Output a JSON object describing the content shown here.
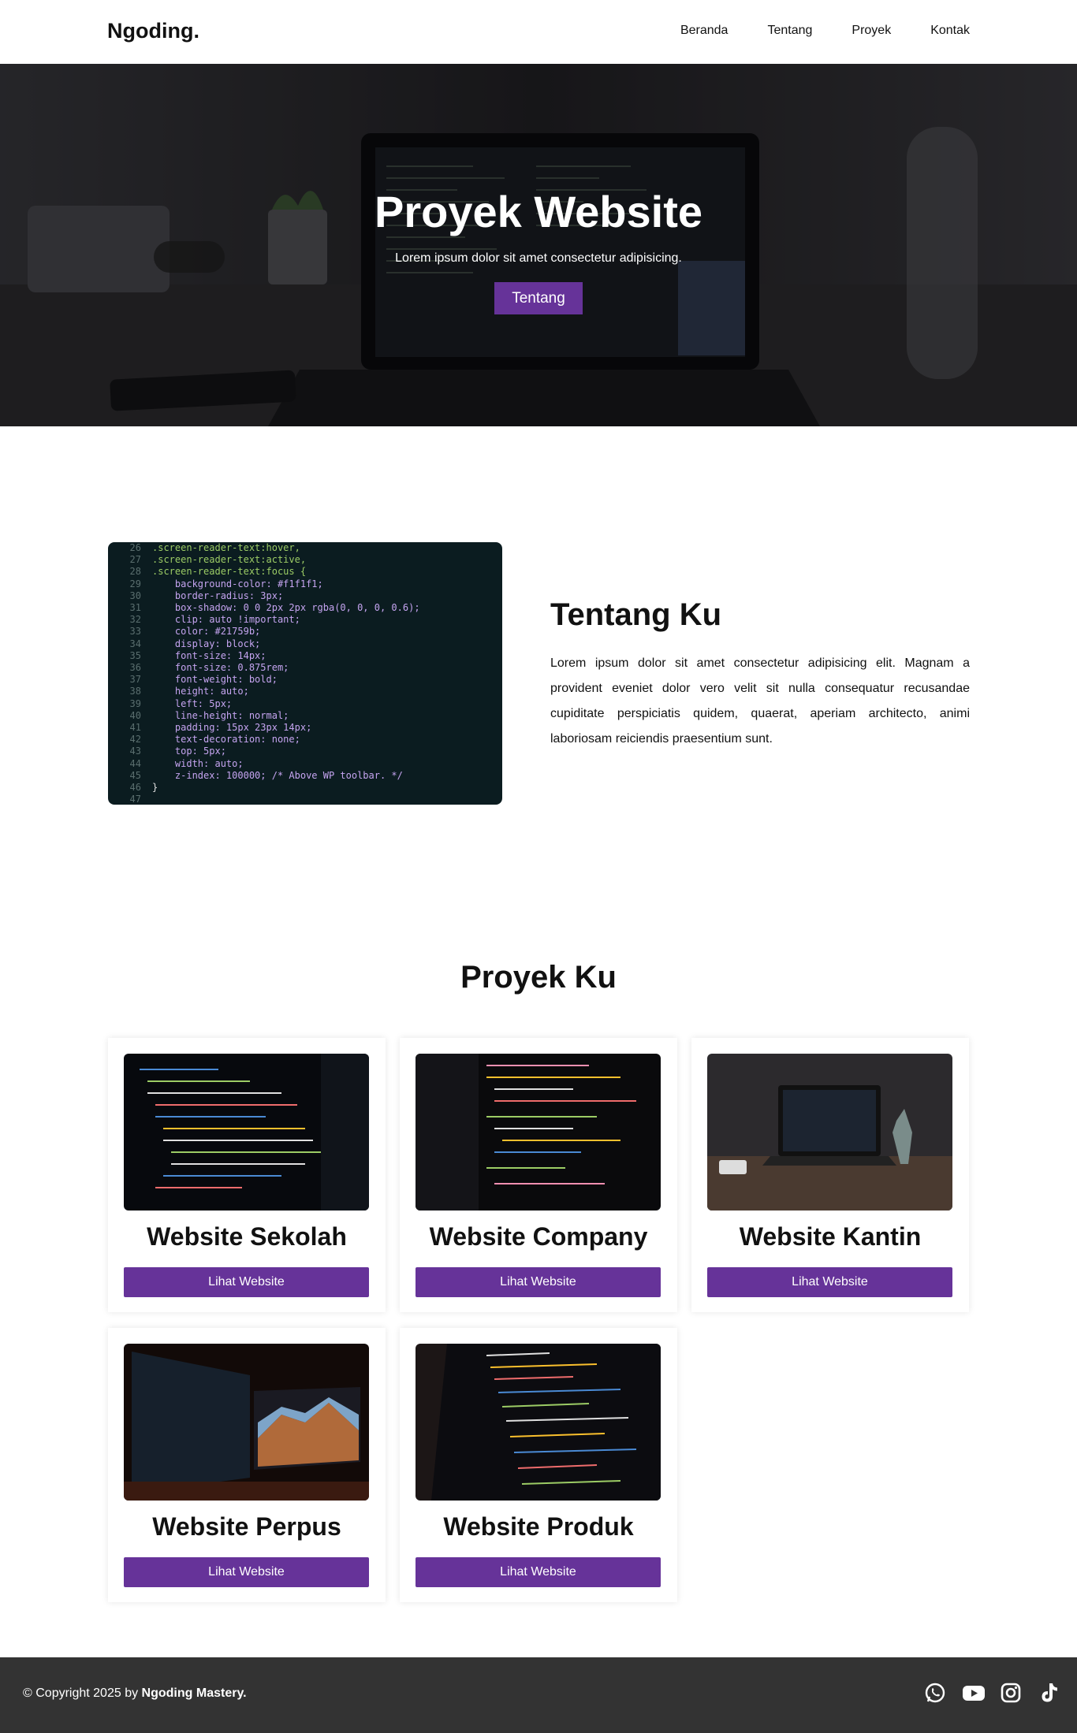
{
  "header": {
    "logo": "Ngoding.",
    "nav": [
      {
        "label": "Beranda"
      },
      {
        "label": "Tentang"
      },
      {
        "label": "Proyek"
      },
      {
        "label": "Kontak"
      }
    ]
  },
  "hero": {
    "title": "Proyek Website",
    "subtitle": "Lorem ipsum dolor sit amet consectetur adipisicing.",
    "button": "Tentang"
  },
  "about": {
    "title": "Tentang Ku",
    "text": "Lorem ipsum dolor sit amet consectetur adipisicing elit. Magnam a provident eveniet dolor vero velit sit nulla consequatur recusandae cupiditate perspiciatis quidem, quaerat, aperiam architecto, animi laboriosam reiciendis praesentium sunt.",
    "code_lines": [
      {
        "n": "26",
        "t": ".screen-reader-text:hover,"
      },
      {
        "n": "27",
        "t": ".screen-reader-text:active,"
      },
      {
        "n": "28",
        "t": ".screen-reader-text:focus {"
      },
      {
        "n": "29",
        "t": "    background-color: #f1f1f1;"
      },
      {
        "n": "30",
        "t": "    border-radius: 3px;"
      },
      {
        "n": "31",
        "t": "    box-shadow: 0 0 2px 2px rgba(0, 0, 0, 0.6);"
      },
      {
        "n": "32",
        "t": "    clip: auto !important;"
      },
      {
        "n": "33",
        "t": "    color: #21759b;"
      },
      {
        "n": "34",
        "t": "    display: block;"
      },
      {
        "n": "35",
        "t": "    font-size: 14px;"
      },
      {
        "n": "36",
        "t": "    font-size: 0.875rem;"
      },
      {
        "n": "37",
        "t": "    font-weight: bold;"
      },
      {
        "n": "38",
        "t": "    height: auto;"
      },
      {
        "n": "39",
        "t": "    left: 5px;"
      },
      {
        "n": "40",
        "t": "    line-height: normal;"
      },
      {
        "n": "41",
        "t": "    padding: 15px 23px 14px;"
      },
      {
        "n": "42",
        "t": "    text-decoration: none;"
      },
      {
        "n": "43",
        "t": "    top: 5px;"
      },
      {
        "n": "44",
        "t": "    width: auto;"
      },
      {
        "n": "45",
        "t": "    z-index: 100000; /* Above WP toolbar. */"
      },
      {
        "n": "46",
        "t": "}"
      },
      {
        "n": "47",
        "t": ""
      }
    ]
  },
  "projects": {
    "title": "Proyek Ku",
    "items": [
      {
        "title": "Website Sekolah",
        "button": "Lihat Website"
      },
      {
        "title": "Website Company",
        "button": "Lihat Website"
      },
      {
        "title": "Website Kantin",
        "button": "Lihat Website"
      },
      {
        "title": "Website Perpus",
        "button": "Lihat Website"
      },
      {
        "title": "Website Produk",
        "button": "Lihat Website"
      }
    ]
  },
  "footer": {
    "copyright_prefix": "© Copyright 2025 by ",
    "copyright_owner": "Ngoding Mastery.",
    "socials": [
      "whatsapp-icon",
      "youtube-icon",
      "instagram-icon",
      "tiktok-icon"
    ]
  },
  "colors": {
    "accent": "#663399",
    "footer_bg": "#333333",
    "hero_overlay": "#2b2a2e"
  }
}
